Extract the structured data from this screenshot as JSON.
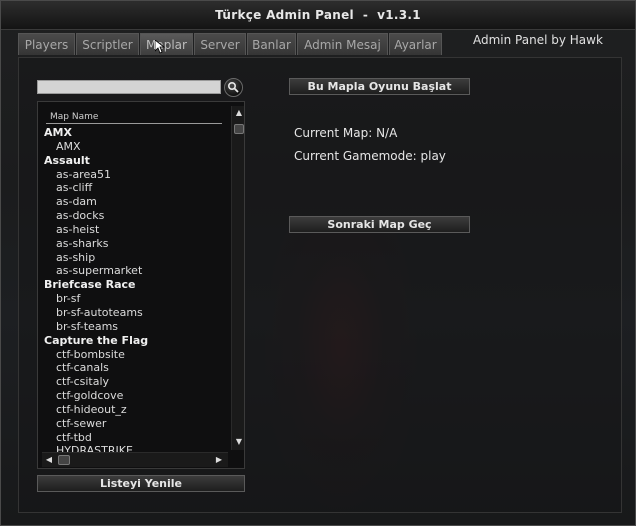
{
  "window": {
    "title": "Türkçe Admin Panel  -  v1.3.1",
    "credit": "Admin Panel by Hawk"
  },
  "tabs": [
    {
      "label": "Players"
    },
    {
      "label": "Scriptler"
    },
    {
      "label": "Maplar",
      "active": true
    },
    {
      "label": "Server"
    },
    {
      "label": "Banlar"
    },
    {
      "label": "Admin Mesaj"
    },
    {
      "label": "Ayarlar"
    }
  ],
  "maps_tab": {
    "search": {
      "value": "",
      "icon": "search-icon"
    },
    "list": {
      "column_header": "Map Name",
      "rows": [
        {
          "text": "AMX",
          "type": "group"
        },
        {
          "text": "AMX",
          "type": "item"
        },
        {
          "text": "Assault",
          "type": "group"
        },
        {
          "text": "as-area51",
          "type": "item"
        },
        {
          "text": "as-cliff",
          "type": "item"
        },
        {
          "text": "as-dam",
          "type": "item"
        },
        {
          "text": "as-docks",
          "type": "item"
        },
        {
          "text": "as-heist",
          "type": "item"
        },
        {
          "text": "as-sharks",
          "type": "item"
        },
        {
          "text": "as-ship",
          "type": "item"
        },
        {
          "text": "as-supermarket",
          "type": "item"
        },
        {
          "text": "Briefcase Race",
          "type": "group"
        },
        {
          "text": "br-sf",
          "type": "item"
        },
        {
          "text": "br-sf-autoteams",
          "type": "item"
        },
        {
          "text": "br-sf-teams",
          "type": "item"
        },
        {
          "text": "Capture the Flag",
          "type": "group"
        },
        {
          "text": "ctf-bombsite",
          "type": "item"
        },
        {
          "text": "ctf-canals",
          "type": "item"
        },
        {
          "text": "ctf-csitaly",
          "type": "item"
        },
        {
          "text": "ctf-goldcove",
          "type": "item"
        },
        {
          "text": "ctf-hideout_z",
          "type": "item"
        },
        {
          "text": "ctf-sewer",
          "type": "item"
        },
        {
          "text": "ctf-tbd",
          "type": "item"
        },
        {
          "text": "HYDRASTRIKE",
          "type": "item"
        }
      ]
    },
    "refresh_label": "Listeyi Yenile",
    "start_map_label": "Bu Mapla Oyunu Başlat",
    "current_map": "Current Map: N/A",
    "current_gamemode": "Current Gamemode: play",
    "next_map_label": "Sonraki Map Geç"
  },
  "colors": {
    "window_bg": "#1d1f22",
    "text": "#e6e6e6",
    "tab_bg": "#4b4b4b",
    "tab_text": "#a8a8a8"
  }
}
